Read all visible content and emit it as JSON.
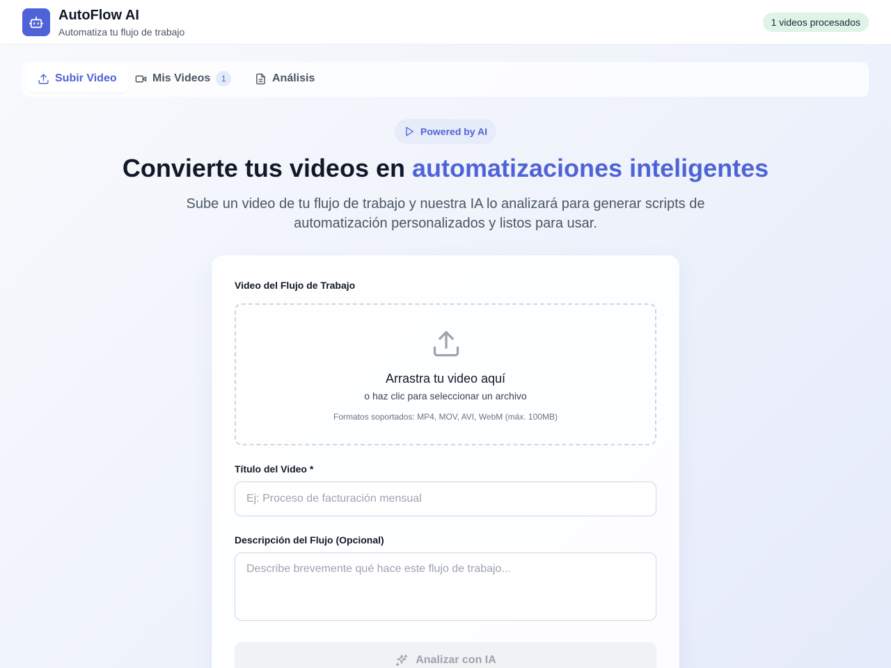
{
  "header": {
    "app_name": "AutoFlow AI",
    "tagline": "Automatiza tu flujo de trabajo",
    "processed_badge": "1 videos procesados"
  },
  "tabs": [
    {
      "label": "Subir Video",
      "icon": "upload-icon",
      "active": true
    },
    {
      "label": "Mis Videos",
      "icon": "video-camera-icon",
      "count": "1",
      "active": false
    },
    {
      "label": "Análisis",
      "icon": "document-icon",
      "active": false
    }
  ],
  "hero": {
    "badge": "Powered by AI",
    "title_plain": "Convierte tus videos en",
    "title_accent": "automatizaciones inteligentes",
    "subtitle": "Sube un video de tu flujo de trabajo y nuestra IA lo analizará para generar scripts de automatización personalizados y listos para usar."
  },
  "form": {
    "video_label": "Video del Flujo de Trabajo",
    "dropzone_title": "Arrastra tu video aquí",
    "dropzone_sub": "o haz clic para seleccionar un archivo",
    "dropzone_formats": "Formatos soportados: MP4, MOV, AVI, WebM (máx. 100MB)",
    "title_label": "Título del Video *",
    "title_value": "",
    "title_placeholder": "Ej: Proceso de facturación mensual",
    "desc_label": "Descripción del Flujo (Opcional)",
    "desc_value": "",
    "desc_placeholder": "Describe brevemente qué hace este flujo de trabajo...",
    "submit_label": "Analizar con IA"
  },
  "colors": {
    "accent": "#4f63d8",
    "badge_green": "#dff3e6",
    "disabled_button": "#f1f2f4"
  }
}
